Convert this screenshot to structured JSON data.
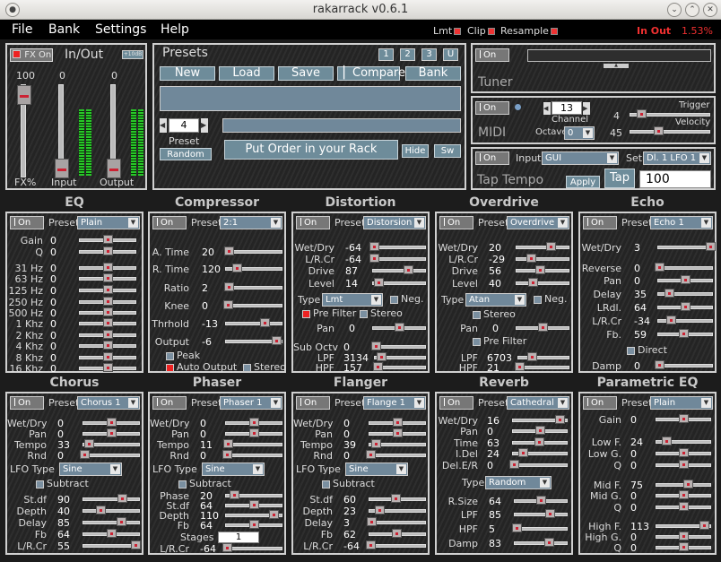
{
  "window": {
    "title": "rakarrack   v0.6.1"
  },
  "menu": [
    "File",
    "Bank",
    "Settings",
    "Help"
  ],
  "status": {
    "lmt": "Lmt",
    "clip": "Clip",
    "resample": "Resample",
    "inout": "In Out",
    "cpu": "1.53%"
  },
  "inout": {
    "title": "In/Out",
    "fx_on": "FX On",
    "v_label": "+10dB",
    "fx_val": "100",
    "in_val": "0",
    "out_val": "0",
    "fx_label": "FX%",
    "in_label": "Input",
    "out_label": "Output",
    "levels": {
      "fx": 100,
      "input": 0,
      "output": 0
    }
  },
  "presets": {
    "title": "Presets",
    "tabs": [
      "1",
      "2",
      "3",
      "U"
    ],
    "new": "New",
    "load": "Load",
    "save": "Save",
    "compare": "Compare",
    "bank": "Bank",
    "number": "4",
    "preset_lbl": "Preset",
    "random": "Random",
    "order": "Put Order in your Rack",
    "hide": "Hide",
    "sw": "Sw"
  },
  "tuner": {
    "on": "On",
    "label": "Tuner"
  },
  "midi": {
    "on": "On",
    "label": "MIDI",
    "channel_val": "13",
    "channel": "Channel",
    "octave": "Octave",
    "octave_val": "0",
    "trigger": "Trigger",
    "velocity": "Velocity",
    "trig_val": "4",
    "vel_val": "45"
  },
  "tap": {
    "on": "On",
    "label": "Tap Tempo",
    "input": "Input",
    "input_val": "GUI",
    "set": "Set",
    "set_val": "Dl. 1 LFO 1",
    "apply": "Apply",
    "tap": "Tap",
    "bpm": "100"
  },
  "eq": {
    "title": "EQ",
    "on": "On",
    "preset": "Preset",
    "preset_val": "Plain",
    "rows": [
      {
        "l": "Gain",
        "v": "0",
        "f": 0.5
      },
      {
        "l": "Q",
        "v": "0",
        "f": 0.5
      },
      {
        "l": "31 Hz",
        "v": "0",
        "f": 0.5
      },
      {
        "l": "63 Hz",
        "v": "0",
        "f": 0.5
      },
      {
        "l": "125 Hz",
        "v": "0",
        "f": 0.5
      },
      {
        "l": "250 Hz",
        "v": "0",
        "f": 0.5
      },
      {
        "l": "500 Hz",
        "v": "0",
        "f": 0.5
      },
      {
        "l": "1 Khz",
        "v": "0",
        "f": 0.5
      },
      {
        "l": "2 Khz",
        "v": "0",
        "f": 0.5
      },
      {
        "l": "4 Khz",
        "v": "0",
        "f": 0.5
      },
      {
        "l": "8 Khz",
        "v": "0",
        "f": 0.5
      },
      {
        "l": "16 Khz",
        "v": "0",
        "f": 0.5
      }
    ]
  },
  "compressor": {
    "title": "Compressor",
    "on": "On",
    "preset": "Preset",
    "preset_val": "2:1",
    "rows": [
      {
        "l": "A. Time",
        "v": "20",
        "f": 0.05
      },
      {
        "l": "R. Time",
        "v": "120",
        "f": 0.2
      },
      {
        "l": "Ratio",
        "v": "2",
        "f": 0.05
      },
      {
        "l": "Knee",
        "v": "0",
        "f": 0.03
      },
      {
        "l": "Thrhold",
        "v": "-13",
        "f": 0.7
      },
      {
        "l": "Output",
        "v": "-6",
        "f": 0.9
      }
    ],
    "peak": "Peak",
    "auto": "Auto Output",
    "stereo": "Stereo"
  },
  "distortion": {
    "title": "Distortion",
    "on": "On",
    "preset": "Preset",
    "preset_val": "Distorsion",
    "rows": [
      {
        "l": "Wet/Dry",
        "v": "-64",
        "f": 0.02
      },
      {
        "l": "L/R.Cr",
        "v": "-64",
        "f": 0.02
      },
      {
        "l": "Drive",
        "v": "87",
        "f": 0.68
      },
      {
        "l": "Level",
        "v": "14",
        "f": 0.11
      }
    ],
    "type": "Type",
    "type_val": "Lmt",
    "neg": "Neg.",
    "prefilter": "Pre Filter",
    "stereo": "Stereo",
    "pan": "Pan",
    "pan_v": "0",
    "pan_f": 0.5,
    "rows2": [
      {
        "l": "Sub Octv",
        "v": "0",
        "f": 0.02
      },
      {
        "l": "LPF",
        "v": "3134",
        "f": 0.13
      },
      {
        "l": "HPF",
        "v": "157",
        "f": 0.05
      }
    ]
  },
  "overdrive": {
    "title": "Overdrive",
    "on": "On",
    "preset": "Preset",
    "preset_val": "Overdrive",
    "rows": [
      {
        "l": "Wet/Dry",
        "v": "20",
        "f": 0.66
      },
      {
        "l": "L/R.Cr",
        "v": "-29",
        "f": 0.27
      },
      {
        "l": "Drive",
        "v": "56",
        "f": 0.44
      },
      {
        "l": "Level",
        "v": "40",
        "f": 0.31
      }
    ],
    "type": "Type",
    "type_val": "Atan",
    "neg": "Neg.",
    "stereo": "Stereo",
    "pan": "Pan",
    "pan_v": "0",
    "pan_f": 0.5,
    "prefilter": "Pre Filter",
    "rows2": [
      {
        "l": "LPF",
        "v": "6703",
        "f": 0.26
      },
      {
        "l": "HPF",
        "v": "21",
        "f": 0.02
      }
    ]
  },
  "echo": {
    "title": "Echo",
    "on": "On",
    "preset": "Preset",
    "preset_val": "Echo 1",
    "rows": [
      {
        "l": "Wet/Dry",
        "v": "3",
        "f": 0.97
      },
      {
        "l": "Reverse",
        "v": "0",
        "f": 0.02
      },
      {
        "l": "Pan",
        "v": "0",
        "f": 0.5
      },
      {
        "l": "Delay",
        "v": "35",
        "f": 0.2
      },
      {
        "l": "LRdl.",
        "v": "64",
        "f": 0.5
      },
      {
        "l": "L/R.Cr",
        "v": "-34",
        "f": 0.23
      },
      {
        "l": "Fb.",
        "v": "59",
        "f": 0.46
      },
      {
        "l": "Damp",
        "v": "0",
        "f": 0.02
      }
    ],
    "direct": "Direct"
  },
  "chorus": {
    "title": "Chorus",
    "on": "On",
    "preset": "Preset",
    "preset_val": "Chorus 1",
    "rows": [
      {
        "l": "Wet/Dry",
        "v": "0",
        "f": 0.5
      },
      {
        "l": "Pan",
        "v": "0",
        "f": 0.5
      },
      {
        "l": "Tempo",
        "v": "33",
        "f": 0.1
      },
      {
        "l": "Rnd",
        "v": "0",
        "f": 0.02
      }
    ],
    "lfo": "LFO Type",
    "lfo_val": "Sine",
    "subtract": "Subtract",
    "rows2": [
      {
        "l": "St.df",
        "v": "90",
        "f": 0.7
      },
      {
        "l": "Depth",
        "v": "40",
        "f": 0.31
      },
      {
        "l": "Delay",
        "v": "85",
        "f": 0.67
      },
      {
        "l": "Fb",
        "v": "64",
        "f": 0.5
      },
      {
        "l": "L/R.Cr",
        "v": "55",
        "f": 0.93
      }
    ]
  },
  "phaser": {
    "title": "Phaser",
    "on": "On",
    "preset": "Preset",
    "preset_val": "Phaser 1",
    "rows": [
      {
        "l": "Wet/Dry",
        "v": "0",
        "f": 0.5
      },
      {
        "l": "Pan",
        "v": "0",
        "f": 0.5
      },
      {
        "l": "Tempo",
        "v": "11",
        "f": 0.03
      },
      {
        "l": "Rnd",
        "v": "0",
        "f": 0.02
      }
    ],
    "lfo": "LFO Type",
    "lfo_val": "Sine",
    "subtract": "Subtract",
    "rows2": [
      {
        "l": "Phase",
        "v": "20",
        "f": 0.15
      },
      {
        "l": "St.df",
        "v": "64",
        "f": 0.5
      },
      {
        "l": "Depth",
        "v": "110",
        "f": 0.86
      },
      {
        "l": "Fb",
        "v": "64",
        "f": 0.5
      }
    ],
    "stages": "Stages",
    "stages_val": "1",
    "lrcr": "L/R.Cr",
    "lrcr_v": "-64",
    "lrcr_f": 0.02
  },
  "flanger": {
    "title": "Flanger",
    "on": "On",
    "preset": "Preset",
    "preset_val": "Flange 1",
    "rows": [
      {
        "l": "Wet/Dry",
        "v": "0",
        "f": 0.5
      },
      {
        "l": "Pan",
        "v": "0",
        "f": 0.5
      },
      {
        "l": "Tempo",
        "v": "39",
        "f": 0.12
      },
      {
        "l": "Rnd",
        "v": "0",
        "f": 0.02
      }
    ],
    "lfo": "LFO Type",
    "lfo_val": "Sine",
    "subtract": "Subtract",
    "rows2": [
      {
        "l": "St.df",
        "v": "60",
        "f": 0.47
      },
      {
        "l": "Depth",
        "v": "23",
        "f": 0.18
      },
      {
        "l": "Delay",
        "v": "3",
        "f": 0.03
      },
      {
        "l": "Fb",
        "v": "62",
        "f": 0.48
      },
      {
        "l": "L/R.Cr",
        "v": "-64",
        "f": 0.02
      }
    ]
  },
  "reverb": {
    "title": "Reverb",
    "on": "On",
    "preset": "Preset",
    "preset_val": "Cathedral 1",
    "rows": [
      {
        "l": "Wet/Dry",
        "v": "16",
        "f": 0.87
      },
      {
        "l": "Pan",
        "v": "0",
        "f": 0.5
      },
      {
        "l": "Time",
        "v": "63",
        "f": 0.49
      },
      {
        "l": "I.Del",
        "v": "24",
        "f": 0.19
      },
      {
        "l": "Del.E/R",
        "v": "0",
        "f": 0.02
      }
    ],
    "type": "Type",
    "type_val": "Random",
    "rows2": [
      {
        "l": "R.Size",
        "v": "64",
        "f": 0.5
      },
      {
        "l": "LPF",
        "v": "85",
        "f": 0.67
      },
      {
        "l": "HPF",
        "v": "5",
        "f": 0.04
      },
      {
        "l": "Damp",
        "v": "83",
        "f": 0.65
      }
    ]
  },
  "peq": {
    "title": "Parametric EQ",
    "on": "On",
    "preset": "Preset",
    "preset_val": "Plain",
    "rows": [
      {
        "l": "Gain",
        "v": "0",
        "f": 0.5
      },
      {
        "l": "Low F.",
        "v": "24",
        "f": 0.19
      },
      {
        "l": "Low G.",
        "v": "0",
        "f": 0.5
      },
      {
        "l": "Q",
        "v": "0",
        "f": 0.5
      },
      {
        "l": "Mid F.",
        "v": "75",
        "f": 0.59
      },
      {
        "l": "Mid G.",
        "v": "0",
        "f": 0.5
      },
      {
        "l": "Q",
        "v": "0",
        "f": 0.5
      },
      {
        "l": "High F.",
        "v": "113",
        "f": 0.89
      },
      {
        "l": "High G.",
        "v": "0",
        "f": 0.5
      },
      {
        "l": "Q",
        "v": "0",
        "f": 0.5
      }
    ]
  }
}
